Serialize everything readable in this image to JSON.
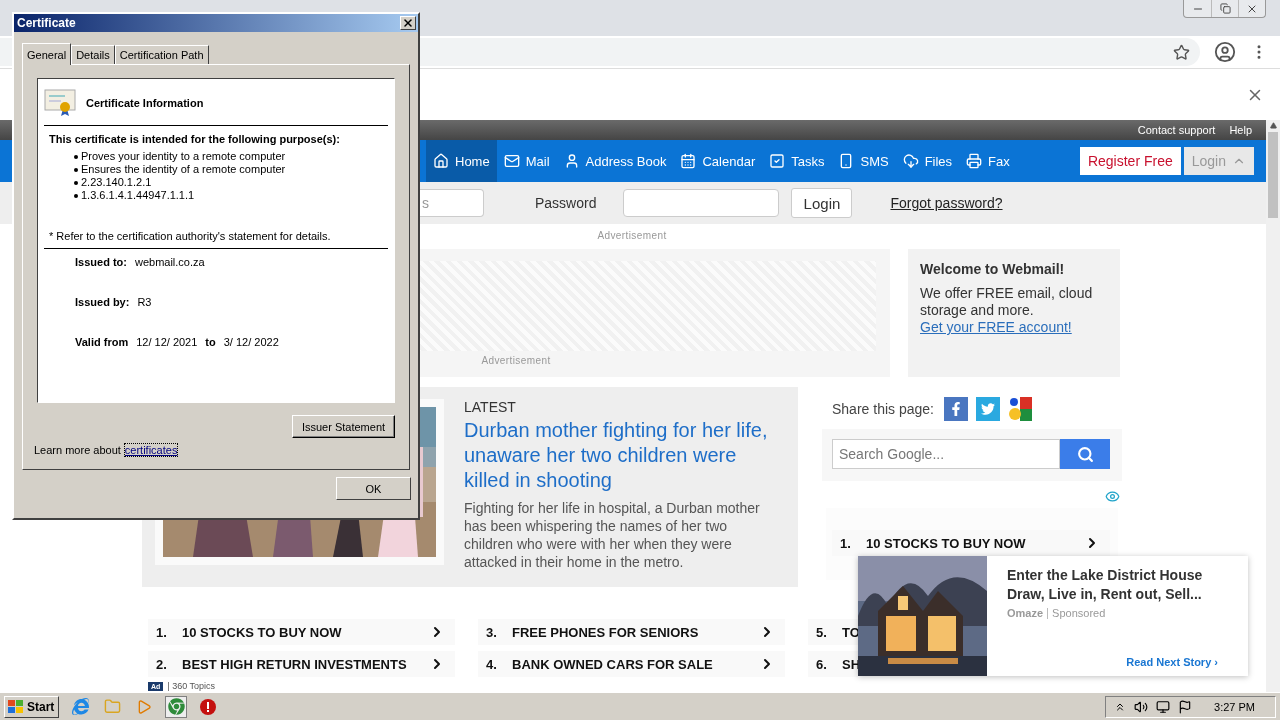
{
  "page": {
    "top_links": [
      "Contact support",
      "Help"
    ],
    "nav": [
      {
        "label": "Home",
        "selected": true
      },
      {
        "label": "Mail",
        "selected": false
      },
      {
        "label": "Address Book",
        "selected": false
      },
      {
        "label": "Calendar",
        "selected": false
      },
      {
        "label": "Tasks",
        "selected": false
      },
      {
        "label": "SMS",
        "selected": false
      },
      {
        "label": "Files",
        "selected": false
      },
      {
        "label": "Fax",
        "selected": false
      }
    ],
    "register_button": "Register Free",
    "login_toggle": "Login",
    "login_form": {
      "username_placeholder": "s",
      "password_label": "Password",
      "login_button": "Login",
      "forgot_link": "Forgot password?"
    },
    "ad_labels": [
      "Advertisement",
      "Advertisement"
    ],
    "welcome": {
      "title": "Welcome to Webmail!",
      "text": "We offer FREE email, cloud storage and more.",
      "link": "Get your FREE account!"
    },
    "article": {
      "section": "LATEST",
      "headline": "Durban mother fighting for her life, unaware her two children were killed in shooting",
      "summary": "Fighting for her life in hospital, a Durban mother has been whispering the names of her two children who were with her when they were attacked in their home in the metro."
    },
    "share_label": "Share this page:",
    "search": {
      "placeholder": "Search Google..."
    },
    "sidebar_topics": [
      {
        "number": "1.",
        "label": "10 STOCKS TO BUY NOW"
      }
    ],
    "topics": [
      {
        "number": "1.",
        "label": "10 STOCKS TO BUY NOW"
      },
      {
        "number": "2.",
        "label": "BEST HIGH RETURN INVESTMENTS"
      },
      {
        "number": "3.",
        "label": "FREE PHONES FOR SENIORS"
      },
      {
        "number": "4.",
        "label": "BANK OWNED CARS FOR SALE"
      },
      {
        "number": "5.",
        "label": "TO"
      },
      {
        "number": "6.",
        "label": "SH"
      }
    ],
    "topics_footer": {
      "badge": "Ad",
      "text": "| 360 Topics"
    },
    "sponsored": {
      "title": "Enter the Lake District House Draw, Live in, Rent out, Sell...",
      "source": "Omaze",
      "tag": "Sponsored",
      "link": "Read Next Story ›"
    }
  },
  "dialog": {
    "title": "Certificate",
    "tabs": [
      {
        "label": "General",
        "selected": true
      },
      {
        "label": "Details",
        "selected": false
      },
      {
        "label": "Certification Path",
        "selected": false
      }
    ],
    "heading": "Certificate Information",
    "purpose_title": "This certificate is intended for the following purpose(s):",
    "purposes": [
      "Proves your identity to a remote computer",
      "Ensures the identity of a remote computer",
      "2.23.140.1.2.1",
      "1.3.6.1.4.1.44947.1.1.1"
    ],
    "note": "* Refer to the certification authority's statement for details.",
    "issued_to_label": "Issued to:",
    "issued_to": "webmail.co.za",
    "issued_by_label": "Issued by:",
    "issued_by": "R3",
    "valid_from_label": "Valid from",
    "valid_from": "12/ 12/ 2021",
    "to_label": "to",
    "valid_to": "3/ 12/ 2022",
    "issuer_button": "Issuer Statement",
    "learn_more": "Learn more about",
    "learn_link": "certificates",
    "ok_button": "OK"
  },
  "taskbar": {
    "start": "Start",
    "clock": "3:27 PM"
  }
}
